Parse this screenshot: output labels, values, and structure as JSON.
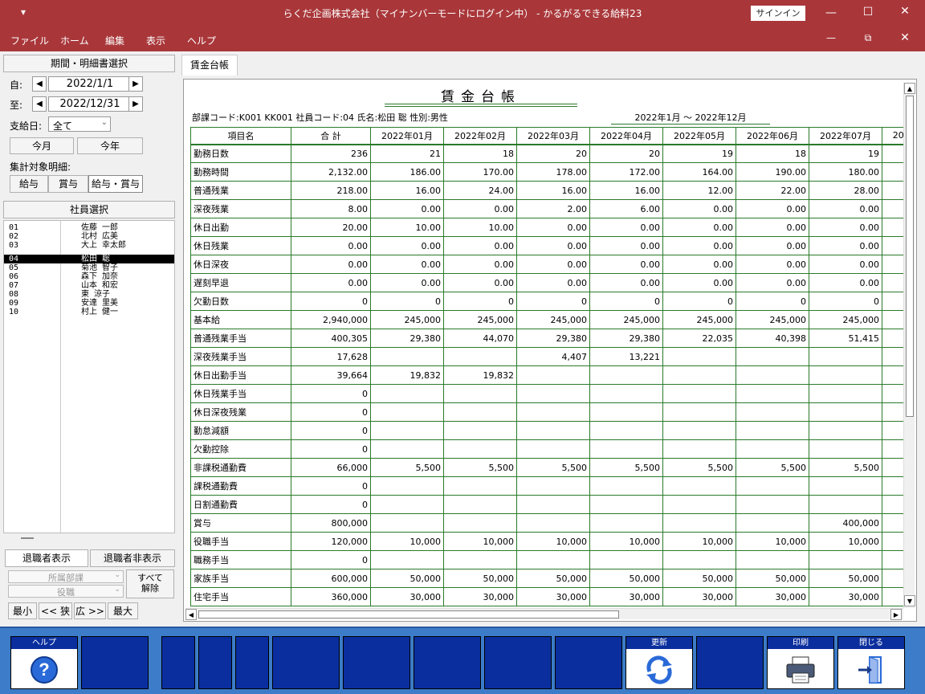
{
  "window": {
    "title": "らくだ企画株式会社（マイナンバーモードにログイン中） - かるがるできる給料23",
    "signin": "サインイン",
    "quick_access": "▾"
  },
  "menu": [
    "ファイル",
    "ホーム",
    "編集",
    "表示",
    "ヘルプ"
  ],
  "left": {
    "period_header": "期間・明細書選択",
    "from_label": "自:",
    "from_date": "2022/1/1",
    "to_label": "至:",
    "to_date": "2022/12/31",
    "payday_label": "支給日:",
    "payday_value": "全て",
    "this_month": "今月",
    "this_year": "今年",
    "target_label": "集計対象明細:",
    "target_buttons": [
      "給与",
      "賞与",
      "給与・賞与"
    ],
    "employee_header": "社員選択",
    "employees": [
      {
        "code": "01",
        "name": "佐藤 一郎"
      },
      {
        "code": "02",
        "name": "北村 広美"
      },
      {
        "code": "03",
        "name": "大上 幸太郎"
      },
      {
        "code": "04",
        "name": "松田 聡"
      },
      {
        "code": "05",
        "name": "菊池 智子"
      },
      {
        "code": "06",
        "name": "森下 加奈"
      },
      {
        "code": "07",
        "name": "山本 和宏"
      },
      {
        "code": "08",
        "name": "東 涼子"
      },
      {
        "code": "09",
        "name": "安達 里美"
      },
      {
        "code": "10",
        "name": "村上 健一"
      }
    ],
    "show_retired": "退職者表示",
    "hide_retired": "退職者非表示",
    "dept_placeholder": "所属部課",
    "title_placeholder": "役職",
    "clear_all": "すべて解除",
    "size_buttons": [
      "最小",
      "<< 狭",
      "広 >>",
      "最大"
    ]
  },
  "tab": "賃金台帳",
  "report": {
    "title": "賃金台帳",
    "header": "部課コード:K001 KK001 社員コード:04 氏名:松田 聡 性別:男性",
    "period": "2022年1月 ～ 2022年12月",
    "columns": [
      "項目名",
      "合 計",
      "2022年01月",
      "2022年02月",
      "2022年03月",
      "2022年04月",
      "2022年05月",
      "2022年06月",
      "2022年07月",
      "20"
    ],
    "rows": [
      [
        "勤務日数",
        "236",
        "21",
        "18",
        "20",
        "20",
        "19",
        "18",
        "19"
      ],
      [
        "勤務時間",
        "2,132.00",
        "186.00",
        "170.00",
        "178.00",
        "172.00",
        "164.00",
        "190.00",
        "180.00"
      ],
      [
        "普通残業",
        "218.00",
        "16.00",
        "24.00",
        "16.00",
        "16.00",
        "12.00",
        "22.00",
        "28.00"
      ],
      [
        "深夜残業",
        "8.00",
        "0.00",
        "0.00",
        "2.00",
        "6.00",
        "0.00",
        "0.00",
        "0.00"
      ],
      [
        "休日出勤",
        "20.00",
        "10.00",
        "10.00",
        "0.00",
        "0.00",
        "0.00",
        "0.00",
        "0.00"
      ],
      [
        "休日残業",
        "0.00",
        "0.00",
        "0.00",
        "0.00",
        "0.00",
        "0.00",
        "0.00",
        "0.00"
      ],
      [
        "休日深夜",
        "0.00",
        "0.00",
        "0.00",
        "0.00",
        "0.00",
        "0.00",
        "0.00",
        "0.00"
      ],
      [
        "遅刻早退",
        "0.00",
        "0.00",
        "0.00",
        "0.00",
        "0.00",
        "0.00",
        "0.00",
        "0.00"
      ],
      [
        "欠勤日数",
        "0",
        "0",
        "0",
        "0",
        "0",
        "0",
        "0",
        "0"
      ],
      [
        "基本給",
        "2,940,000",
        "245,000",
        "245,000",
        "245,000",
        "245,000",
        "245,000",
        "245,000",
        "245,000"
      ],
      [
        "普通残業手当",
        "400,305",
        "29,380",
        "44,070",
        "29,380",
        "29,380",
        "22,035",
        "40,398",
        "51,415"
      ],
      [
        "深夜残業手当",
        "17,628",
        "",
        "",
        "4,407",
        "13,221",
        "",
        "",
        ""
      ],
      [
        "休日出勤手当",
        "39,664",
        "19,832",
        "19,832",
        "",
        "",
        "",
        "",
        ""
      ],
      [
        "休日残業手当",
        "0",
        "",
        "",
        "",
        "",
        "",
        "",
        ""
      ],
      [
        "休日深夜残業",
        "0",
        "",
        "",
        "",
        "",
        "",
        "",
        ""
      ],
      [
        "勤怠減額",
        "0",
        "",
        "",
        "",
        "",
        "",
        "",
        ""
      ],
      [
        "欠勤控除",
        "0",
        "",
        "",
        "",
        "",
        "",
        "",
        ""
      ],
      [
        "非課税通勤費",
        "66,000",
        "5,500",
        "5,500",
        "5,500",
        "5,500",
        "5,500",
        "5,500",
        "5,500"
      ],
      [
        "課税通勤費",
        "0",
        "",
        "",
        "",
        "",
        "",
        "",
        ""
      ],
      [
        "日割通勤費",
        "0",
        "",
        "",
        "",
        "",
        "",
        "",
        ""
      ],
      [
        "賞与",
        "800,000",
        "",
        "",
        "",
        "",
        "",
        "",
        "400,000"
      ],
      [
        "役職手当",
        "120,000",
        "10,000",
        "10,000",
        "10,000",
        "10,000",
        "10,000",
        "10,000",
        "10,000"
      ],
      [
        "職務手当",
        "0",
        "",
        "",
        "",
        "",
        "",
        "",
        ""
      ],
      [
        "家族手当",
        "600,000",
        "50,000",
        "50,000",
        "50,000",
        "50,000",
        "50,000",
        "50,000",
        "50,000"
      ],
      [
        "住宅手当",
        "360,000",
        "30,000",
        "30,000",
        "30,000",
        "30,000",
        "30,000",
        "30,000",
        "30,000"
      ]
    ]
  },
  "fkeys": {
    "help": "ヘルプ",
    "refresh": "更新",
    "print": "印刷",
    "close": "閉じる"
  }
}
